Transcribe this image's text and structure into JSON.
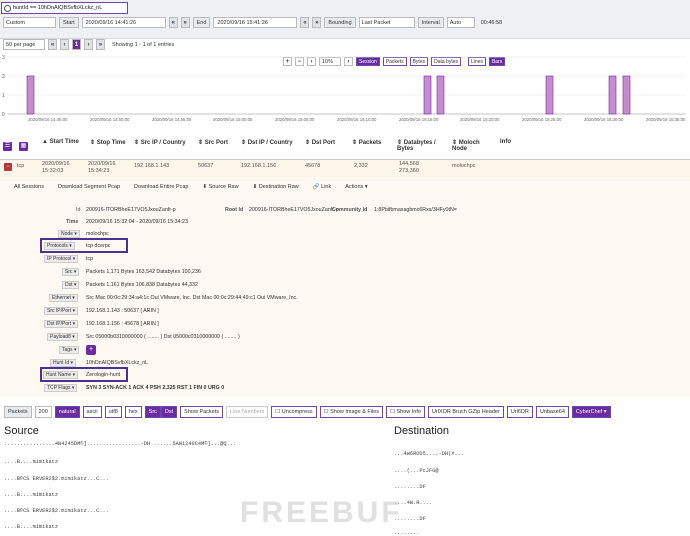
{
  "search": {
    "query": "huntId == 10hDnAIQBSvfbXLckz_nL"
  },
  "timebar": {
    "range": "Custom",
    "start_label": "Start",
    "start": "2020/09/16 14:41:26",
    "end_label": "End",
    "end": "2020/09/16 15:41:26",
    "bounding_label": "Bounding",
    "bounding": "Last Packet",
    "interval_label": "Interval",
    "interval": "Auto",
    "duration": "00:46:58"
  },
  "paging": {
    "per_page": "50 per page",
    "showing": "Showing 1 - 1 of 1 entries"
  },
  "chart_controls": {
    "zoom": "10%",
    "buttons": [
      "Session",
      "Packets",
      "Bytes",
      "Data bytes"
    ],
    "mode_buttons": [
      "Lines",
      "Bars"
    ]
  },
  "chart_data": {
    "type": "bar",
    "y_ticks": [
      "3",
      "2",
      "1",
      "0"
    ],
    "x_ticks": [
      "2020/09/16 14:45:00",
      "2020/09/16 14:50:00",
      "2020/09/16 14:55:00",
      "2020/09/16 15:00:00",
      "2020/09/16 15:05:00",
      "2020/09/16 15:10:00",
      "2020/09/16 15:15:00",
      "2020/09/16 15:20:00",
      "2020/09/16 15:25:00",
      "2020/09/16 15:30:00",
      "2020/09/16 15:35:00"
    ]
  },
  "table": {
    "headers": [
      "Start Time",
      "Stop Time",
      "Src IP / Country",
      "Src Port",
      "Dst IP / Country",
      "Dst Port",
      "Packets",
      "Databytes / Bytes",
      "Moloch Node",
      "Info"
    ],
    "row": [
      "tcp",
      "2020/09/16 15:32:03",
      "2020/09/16 15:34:23",
      "192.168.1.143",
      "50637",
      "192.168.1.156",
      "45678",
      "2,332",
      "144,568 273,360",
      "molochpc"
    ]
  },
  "session_actions": [
    "All Sessions",
    "Download Segment Pcap",
    "Download Entire Pcap",
    "Source Raw",
    "Destination Raw",
    "Link",
    "Actions"
  ],
  "detail": {
    "id_label": "Id",
    "id": "200916-ITORBheE17VO5JxouZanfr-p",
    "root_label": "Root Id",
    "root": "200916-ITORBheE17VO5JxouZanfr-p",
    "community_label": "Community Id",
    "community": "1:8Pbifbmaxagbmc6Rxs/3HFy0tN=",
    "time_label": "Time",
    "time": "2020/09/16 15:32:04 - 2020/09/16 15:34:23",
    "node_label": "Node",
    "node": "molochpc",
    "protocols_label": "Protocols",
    "protocols": "tcp  dcerpc",
    "ipproto_label": "IP Protocol",
    "ipproto": "tcp",
    "src_label": "Src",
    "src": "Packets 1,171   Bytes 163,542   Databytes 100,236",
    "dst_label": "Dst",
    "dst": "Packets 1,161   Bytes 106,838   Databytes 44,332",
    "eth_label": "Ethernet",
    "eth": "Src Mac 00:0c:29:34:a4:1c  Oui VMware, Inc.   Dst Mac 00:0c:29:44:49:c1  Oui VMware, Inc.",
    "srcip_label": "Src IP/Port",
    "srcip": "192.168.1.143 : 50637 [ ARIN ]",
    "dstip_label": "Dst IP/Port",
    "dstip": "192.168.1.156 : 45678 [ ARIN ]",
    "payload_label": "Payload8",
    "payload": "Src 05000b0310000000 ( ........ )   Dst 05000c0310000000 ( ........ )",
    "tags_label": "Tags",
    "huntid_label": "Hunt Id",
    "huntid": "10hDnAIQBSvfbXLckz_nL",
    "huntname_label": "Hunt Name",
    "huntname": "Zerologin-hunt",
    "tcp_label": "TCP Flags",
    "tcp": "SYN 3    SYN-ACK 1    ACK 4    PSH 2,325    RST 1    FIN 0    URG 0"
  },
  "packet_bar": [
    "Packets",
    "200",
    "natural",
    "ascii",
    "utf8",
    "hex",
    "Src",
    "Dst",
    "Show Packets",
    "Line Numbers",
    "Uncompress",
    "Show Image & Files",
    "Show Info",
    "UrlXOR Bruch GZip Header",
    "Url6DR",
    "Unbase64",
    "CyberChef"
  ],
  "source": {
    "title": "Source",
    "lines": [
      "................4W4245DM©].................-DH ......5AW1240C4M©]...@Q...",
      "....B....mimikatz",
      "....B©CS ERVER2$2.mimikatz...C...",
      "....B....mimikatz",
      "....B©CS ERVER2$2.mimikatz...C...",
      "....B....mimikatz"
    ]
  },
  "destination": {
    "title": "Destination",
    "lines": [
      "...4W6ROD5....-DH(#...",
      "....(...PcJFG@",
      "........DF",
      "....4W.R....",
      "........DF",
      "........"
    ]
  },
  "watermark": "FREEBUF"
}
